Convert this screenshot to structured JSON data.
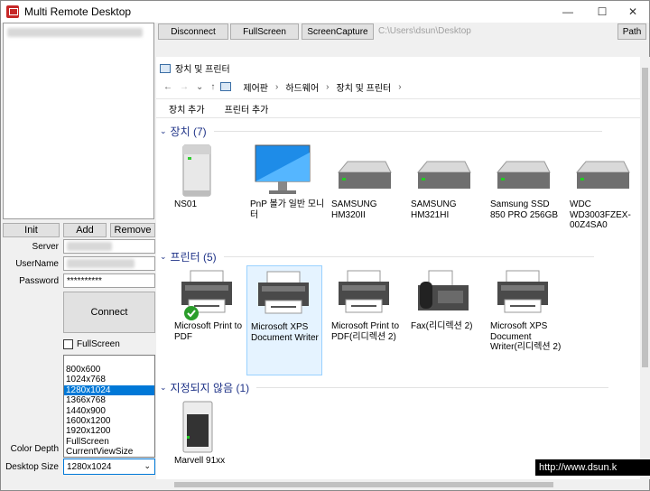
{
  "window": {
    "title": "Multi Remote Desktop",
    "minimize": "—",
    "maximize": "☐",
    "close": "✕"
  },
  "left": {
    "buttons": {
      "init": "Init",
      "add": "Add",
      "remove": "Remove"
    },
    "labels": {
      "server": "Server",
      "username": "UserName",
      "password": "Password",
      "color_depth": "Color Depth",
      "desktop_size": "Desktop Size"
    },
    "password_value": "**********",
    "connect": "Connect",
    "fullscreen": "FullScreen",
    "desktop_size_options": [
      "800x600",
      "1024x768",
      "1280x1024",
      "1366x768",
      "1440x900",
      "1600x1200",
      "1920x1200",
      "FullScreen",
      "CurrentViewSize"
    ],
    "desktop_size_value": "1280x1024"
  },
  "toolbar": {
    "disconnect": "Disconnect",
    "fullscreen": "FullScreen",
    "capture": "ScreenCapture",
    "path_text": "C:\\Users\\dsun\\Desktop",
    "path_btn": "Path"
  },
  "explorer": {
    "title": "장치 및 프린터",
    "breadcrumb": [
      "제어판",
      "하드웨어",
      "장치 및 프린터"
    ],
    "commands": [
      "장치 추가",
      "프린터 추가"
    ],
    "groups": [
      {
        "title": "장치 (7)",
        "items": [
          "NS01",
          "PnP 볼가 일반 모니터",
          "SAMSUNG HM320II",
          "SAMSUNG HM321HI",
          "Samsung SSD 850 PRO 256GB",
          "WDC WD3003FZEX-00Z4SA0"
        ]
      },
      {
        "title": "프린터 (5)",
        "items": [
          "Microsoft Print to PDF",
          "Microsoft XPS Document Writer",
          "Microsoft Print to PDF(리디렉션 2)",
          "Fax(리디렉션 2)",
          "Microsoft XPS Document Writer(리디렉션 2)"
        ]
      },
      {
        "title": "지정되지 않음 (1)",
        "items": [
          "Marvell 91xx"
        ]
      }
    ]
  },
  "watermark": "http://www.dsun.k"
}
